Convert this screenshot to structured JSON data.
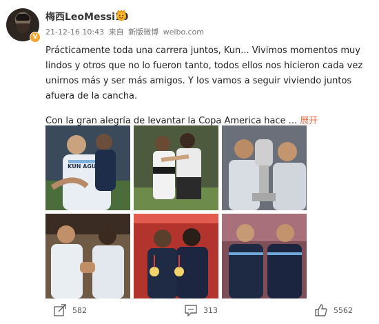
{
  "post": {
    "author": "梅西LeoMessi10",
    "verified_badge": "V",
    "date": "21-12-16 10:43",
    "source_prefix": "来自",
    "source_app": "新版微博",
    "source_site": "weibo.com",
    "text_1": "Prácticamente toda una carrera juntos, Kun... Vivimos momentos muy lindos y otros que no lo fueron tanto, todos ellos nos hicieron cada vez unirnos más y ser más amigos. Y los vamos a seguir viviendo juntos afuera de la cancha.",
    "text_2": "Con la gran alegría de levantar la Copa America hace ...",
    "expand_label": "展开",
    "jersey_text": "KUN AGUERO"
  },
  "actions": {
    "repost_count": "582",
    "comment_count": "313",
    "like_count": "5562"
  },
  "colors": {
    "accent": "#eb7350",
    "badge": "#f4a531"
  },
  "icons": [
    "share-icon",
    "comment-icon",
    "like-icon",
    "vip-face-icon"
  ]
}
